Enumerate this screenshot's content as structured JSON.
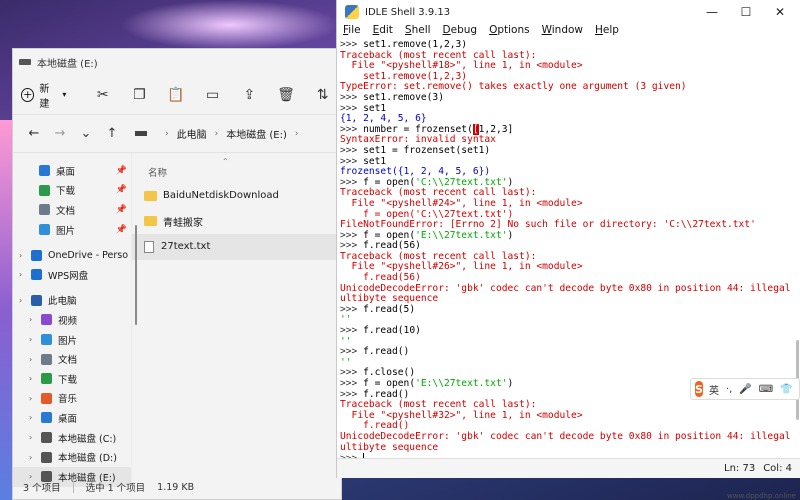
{
  "explorer": {
    "title": "本地磁盘 (E:)",
    "toolbar": {
      "new_label": "新建"
    },
    "breadcrumb": [
      "此电脑",
      "本地磁盘 (E:)"
    ],
    "sidebar": [
      {
        "label": "桌面",
        "icon": "desktop-icon",
        "pinned": true
      },
      {
        "label": "下载",
        "icon": "download-icon",
        "pinned": true
      },
      {
        "label": "文档",
        "icon": "document-icon",
        "pinned": true
      },
      {
        "label": "图片",
        "icon": "picture-icon",
        "pinned": true
      },
      {
        "label": "OneDrive - Perso",
        "icon": "cloud-icon",
        "pinned": false
      },
      {
        "label": "WPS网盘",
        "icon": "cloud-icon",
        "pinned": false
      },
      {
        "label": "此电脑",
        "icon": "pc-icon",
        "pinned": false
      },
      {
        "label": "视频",
        "icon": "video-icon",
        "pinned": false
      },
      {
        "label": "图片",
        "icon": "picture-icon",
        "pinned": false
      },
      {
        "label": "文档",
        "icon": "document-icon",
        "pinned": false
      },
      {
        "label": "下载",
        "icon": "download-icon",
        "pinned": false
      },
      {
        "label": "音乐",
        "icon": "music-icon",
        "pinned": false
      },
      {
        "label": "桌面",
        "icon": "desktop-icon",
        "pinned": false
      },
      {
        "label": "本地磁盘 (C:)",
        "icon": "drive-icon",
        "pinned": false
      },
      {
        "label": "本地磁盘 (D:)",
        "icon": "drive-icon",
        "pinned": false
      },
      {
        "label": "本地磁盘 (E:)",
        "icon": "drive-icon",
        "pinned": false
      }
    ],
    "column_name": "名称",
    "files": [
      {
        "name": "BaiduNetdiskDownload",
        "type": "folder"
      },
      {
        "name": "青蛙搬家",
        "type": "folder"
      },
      {
        "name": "27text.txt",
        "type": "txt"
      }
    ],
    "status": {
      "count": "3 个项目",
      "selected": "选中 1 个项目",
      "size": "1.19 KB"
    }
  },
  "idle": {
    "title": "IDLE Shell 3.9.13",
    "menu": [
      "File",
      "Edit",
      "Shell",
      "Debug",
      "Options",
      "Window",
      "Help"
    ],
    "status": {
      "line": "Ln: 73",
      "col": "Col: 4"
    },
    "lines": [
      {
        "p": ">>> ",
        "t": "set1.remove(1,2,3)",
        "c": "code"
      },
      {
        "p": "",
        "t": "Traceback (most recent call last):",
        "c": "err"
      },
      {
        "p": "",
        "t": "  File \"<pyshell#18>\", line 1, in <module>",
        "c": "err"
      },
      {
        "p": "",
        "t": "    set1.remove(1,2,3)",
        "c": "err"
      },
      {
        "p": "",
        "t": "TypeError: set.remove() takes exactly one argument (3 given)",
        "c": "err"
      },
      {
        "p": ">>> ",
        "t": "set1.remove(3)",
        "c": "code"
      },
      {
        "p": ">>> ",
        "t": "set1",
        "c": "code"
      },
      {
        "p": "",
        "t": "{1, 2, 4, 5, 6}",
        "c": "out"
      },
      {
        "p": ">>> ",
        "t": "number = frozenset(",
        "t2": "[",
        "t3": "1,2,3]",
        "c": "code",
        "special": "frozen"
      },
      {
        "p": "",
        "t": "SyntaxError: invalid syntax",
        "c": "err"
      },
      {
        "p": ">>> ",
        "t": "set1 = frozenset(set1)",
        "c": "code"
      },
      {
        "p": ">>> ",
        "t": "set1",
        "c": "code"
      },
      {
        "p": "",
        "t": "frozenset({1, 2, 4, 5, 6})",
        "c": "out"
      },
      {
        "p": ">>> ",
        "t": "f = open(",
        "s": "'C:\\\\27text.txt'",
        "e": ")",
        "c": "code",
        "special": "open"
      },
      {
        "p": "",
        "t": "Traceback (most recent call last):",
        "c": "err"
      },
      {
        "p": "",
        "t": "  File \"<pyshell#24>\", line 1, in <module>",
        "c": "err"
      },
      {
        "p": "",
        "t": "    f = open('C:\\\\27text.txt')",
        "c": "err"
      },
      {
        "p": "",
        "t": "FileNotFoundError: [Errno 2] No such file or directory: 'C:\\\\27text.txt'",
        "c": "err"
      },
      {
        "p": ">>> ",
        "t": "f = open(",
        "s": "'E:\\\\27text.txt'",
        "e": ")",
        "c": "code",
        "special": "open"
      },
      {
        "p": ">>> ",
        "t": "f.read(56)",
        "c": "code"
      },
      {
        "p": "",
        "t": "Traceback (most recent call last):",
        "c": "err"
      },
      {
        "p": "",
        "t": "  File \"<pyshell#26>\", line 1, in <module>",
        "c": "err"
      },
      {
        "p": "",
        "t": "    f.read(56)",
        "c": "err"
      },
      {
        "p": "",
        "t": "UnicodeDecodeError: 'gbk' codec can't decode byte 0x80 in position 44: illegal m",
        "c": "err"
      },
      {
        "p": "",
        "t": "ultibyte sequence",
        "c": "err"
      },
      {
        "p": ">>> ",
        "t": "f.read(5)",
        "c": "code"
      },
      {
        "p": "",
        "t": "''",
        "c": "str"
      },
      {
        "p": ">>> ",
        "t": "f.read(10)",
        "c": "code"
      },
      {
        "p": "",
        "t": "''",
        "c": "str"
      },
      {
        "p": ">>> ",
        "t": "f.read()",
        "c": "code"
      },
      {
        "p": "",
        "t": "''",
        "c": "str"
      },
      {
        "p": ">>> ",
        "t": "f.close()",
        "c": "code"
      },
      {
        "p": ">>> ",
        "t": "f = open(",
        "s": "'E:\\\\27text.txt'",
        "e": ")",
        "c": "code",
        "special": "open"
      },
      {
        "p": ">>> ",
        "t": "f.read()",
        "c": "code"
      },
      {
        "p": "",
        "t": "Traceback (most recent call last):",
        "c": "err"
      },
      {
        "p": "",
        "t": "  File \"<pyshell#32>\", line 1, in <module>",
        "c": "err"
      },
      {
        "p": "",
        "t": "    f.read()",
        "c": "err"
      },
      {
        "p": "",
        "t": "UnicodeDecodeError: 'gbk' codec can't decode byte 0x80 in position 44: illegal m",
        "c": "err"
      },
      {
        "p": "",
        "t": "ultibyte sequence",
        "c": "err"
      },
      {
        "p": ">>> ",
        "t": "",
        "c": "code",
        "special": "caret"
      }
    ]
  },
  "ime": {
    "logo": "S",
    "mode": "英",
    "items": [
      "·,",
      "🎤",
      "⌨",
      "👕",
      "⠿"
    ]
  },
  "watermark": "www.dppdhp.online"
}
